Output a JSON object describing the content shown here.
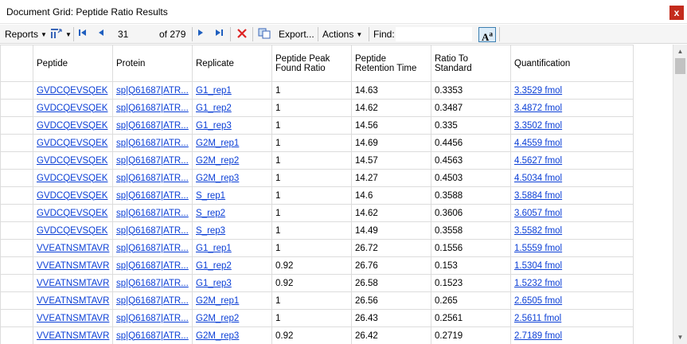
{
  "window": {
    "title": "Document Grid: Peptide Ratio Results",
    "close_label": "x"
  },
  "toolbar": {
    "reports_label": "Reports",
    "position_value": "31",
    "of_label": "of 279",
    "export_label": "Export...",
    "actions_label": "Actions",
    "find_label": "Find:",
    "find_value": "",
    "font_label": "A",
    "font_sup": "a"
  },
  "grid": {
    "columns": [
      "Peptide",
      "Protein",
      "Replicate",
      "Peptide Peak Found Ratio",
      "Peptide Retention Time",
      "Ratio To Standard",
      "Quantification"
    ],
    "rows": [
      [
        "GVDCQEVSQEK",
        "sp|Q61687|ATR...",
        "G1_rep1",
        "1",
        "14.63",
        "0.3353",
        "3.3529 fmol"
      ],
      [
        "GVDCQEVSQEK",
        "sp|Q61687|ATR...",
        "G1_rep2",
        "1",
        "14.62",
        "0.3487",
        "3.4872 fmol"
      ],
      [
        "GVDCQEVSQEK",
        "sp|Q61687|ATR...",
        "G1_rep3",
        "1",
        "14.56",
        "0.335",
        "3.3502 fmol"
      ],
      [
        "GVDCQEVSQEK",
        "sp|Q61687|ATR...",
        "G2M_rep1",
        "1",
        "14.69",
        "0.4456",
        "4.4559 fmol"
      ],
      [
        "GVDCQEVSQEK",
        "sp|Q61687|ATR...",
        "G2M_rep2",
        "1",
        "14.57",
        "0.4563",
        "4.5627 fmol"
      ],
      [
        "GVDCQEVSQEK",
        "sp|Q61687|ATR...",
        "G2M_rep3",
        "1",
        "14.27",
        "0.4503",
        "4.5034 fmol"
      ],
      [
        "GVDCQEVSQEK",
        "sp|Q61687|ATR...",
        "S_rep1",
        "1",
        "14.6",
        "0.3588",
        "3.5884 fmol"
      ],
      [
        "GVDCQEVSQEK",
        "sp|Q61687|ATR...",
        "S_rep2",
        "1",
        "14.62",
        "0.3606",
        "3.6057 fmol"
      ],
      [
        "GVDCQEVSQEK",
        "sp|Q61687|ATR...",
        "S_rep3",
        "1",
        "14.49",
        "0.3558",
        "3.5582 fmol"
      ],
      [
        "VVEATNSMTAVR",
        "sp|Q61687|ATR...",
        "G1_rep1",
        "1",
        "26.72",
        "0.1556",
        "1.5559 fmol"
      ],
      [
        "VVEATNSMTAVR",
        "sp|Q61687|ATR...",
        "G1_rep2",
        "0.92",
        "26.76",
        "0.153",
        "1.5304 fmol"
      ],
      [
        "VVEATNSMTAVR",
        "sp|Q61687|ATR...",
        "G1_rep3",
        "0.92",
        "26.58",
        "0.1523",
        "1.5232 fmol"
      ],
      [
        "VVEATNSMTAVR",
        "sp|Q61687|ATR...",
        "G2M_rep1",
        "1",
        "26.56",
        "0.265",
        "2.6505 fmol"
      ],
      [
        "VVEATNSMTAVR",
        "sp|Q61687|ATR...",
        "G2M_rep2",
        "1",
        "26.43",
        "0.2561",
        "2.5611 fmol"
      ],
      [
        "VVEATNSMTAVR",
        "sp|Q61687|ATR...",
        "G2M_rep3",
        "0.92",
        "26.42",
        "0.2719",
        "2.7189 fmol"
      ]
    ]
  },
  "icons": {
    "layout": "column-layout-icon",
    "first": "first-record-icon",
    "prev": "previous-record-icon",
    "next": "next-record-icon",
    "last": "last-record-icon",
    "delete": "delete-icon",
    "copy": "copy-icon"
  },
  "colors": {
    "link": "#0b3fd6",
    "close_button": "#c42b1c",
    "delete": "#d22"
  }
}
